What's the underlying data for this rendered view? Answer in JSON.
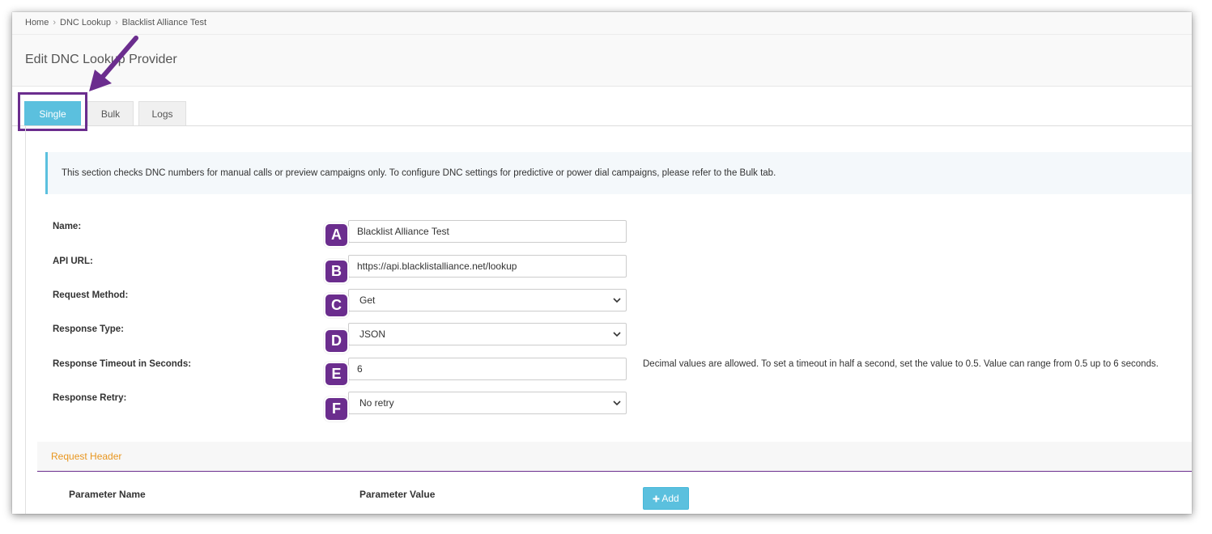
{
  "breadcrumb": {
    "items": [
      "Home",
      "DNC Lookup",
      "Blacklist Alliance Test"
    ],
    "separator": "›"
  },
  "page": {
    "title": "Edit DNC Lookup Provider"
  },
  "tabs": [
    {
      "label": "Single",
      "active": true
    },
    {
      "label": "Bulk",
      "active": false
    },
    {
      "label": "Logs",
      "active": false
    }
  ],
  "info": {
    "text": "This section checks DNC numbers for manual calls or preview campaigns only. To configure DNC settings for predictive or power dial campaigns, please refer to the Bulk tab."
  },
  "form": {
    "name": {
      "label": "Name:",
      "value": "Blacklist Alliance Test",
      "badge": "A"
    },
    "api_url": {
      "label": "API URL:",
      "value": "https://api.blacklistalliance.net/lookup",
      "badge": "B"
    },
    "request_method": {
      "label": "Request Method:",
      "value": "Get",
      "badge": "C"
    },
    "response_type": {
      "label": "Response Type:",
      "value": "JSON",
      "badge": "D"
    },
    "response_timeout": {
      "label": "Response Timeout in Seconds:",
      "value": "6",
      "badge": "E",
      "help": "Decimal values are allowed. To set a timeout in half a second, set the value to 0.5. Value can range from 0.5 up to 6 seconds."
    },
    "response_retry": {
      "label": "Response Retry:",
      "value": "No retry",
      "badge": "F"
    }
  },
  "request_header": {
    "title": "Request Header",
    "col_name": "Parameter Name",
    "col_value": "Parameter Value",
    "add_label": "Add",
    "add_icon": "plus-icon"
  },
  "colors": {
    "accent": "#5bc0de",
    "annotation": "#6b2d8e",
    "section_title": "#e8961f"
  }
}
